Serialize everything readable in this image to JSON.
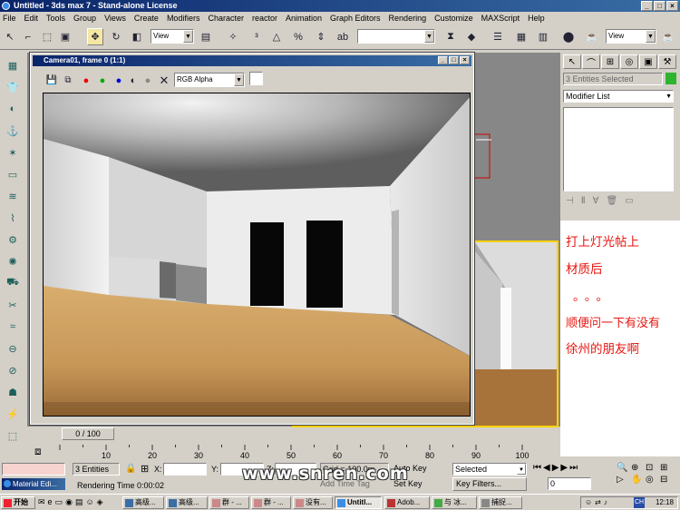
{
  "app": {
    "title": "Untitled - 3ds max 7 - Stand-alone License",
    "window_buttons": [
      "_",
      "□",
      "×"
    ]
  },
  "menu": [
    "File",
    "Edit",
    "Tools",
    "Group",
    "Views",
    "Create",
    "Modifiers",
    "Character",
    "reactor",
    "Animation",
    "Graph Editors",
    "Rendering",
    "Customize",
    "MAXScript",
    "Help"
  ],
  "toolbar": {
    "ref_coord": "View",
    "named_selection": "",
    "view_right": "View"
  },
  "render_window": {
    "title": "Camera01, frame 0 (1:1)",
    "channel": "RGB Alpha",
    "title_buttons": [
      "_",
      "□",
      "×"
    ]
  },
  "command_panel": {
    "selection": "3 Entities Selected",
    "modifier_list": "Modifier List"
  },
  "chat_lines": [
    "打上灯光帖上",
    "材质后",
    "。。。",
    "顺便问一下有没有",
    "徐州的朋友啊"
  ],
  "timeline": {
    "frame": "0 / 100",
    "ticks": [
      "10",
      "20",
      "30",
      "40",
      "50",
      "60",
      "70",
      "80",
      "90",
      "100"
    ]
  },
  "status": {
    "entities": "3 Entities",
    "x_label": "X:",
    "y_label": "Y:",
    "z_label": "Z:",
    "grid": "Grid = 100.0m",
    "auto_key": "Auto Key",
    "set_key": "Set Key",
    "selected": "Selected",
    "key_filters": "Key Filters...",
    "rendering_time": "Rendering Time  0:00:02",
    "add_time_tag": "Add Time Tag",
    "frame_field": "0",
    "material_editor": "Material Edi..."
  },
  "watermark": "www.snren.com",
  "taskbar": {
    "start": "开始",
    "clock": "12:18",
    "ime": "CH",
    "tasks": [
      "高级...",
      "高级...",
      "群 - ...",
      "群 - ...",
      "没有...",
      "Untitl...",
      "Adob...",
      "与 冰...",
      "捕捉..."
    ]
  },
  "colors": {
    "title_blue": "#0a246a",
    "chat_red": "#e8150f",
    "viewport_yellow": "#ffd200"
  }
}
